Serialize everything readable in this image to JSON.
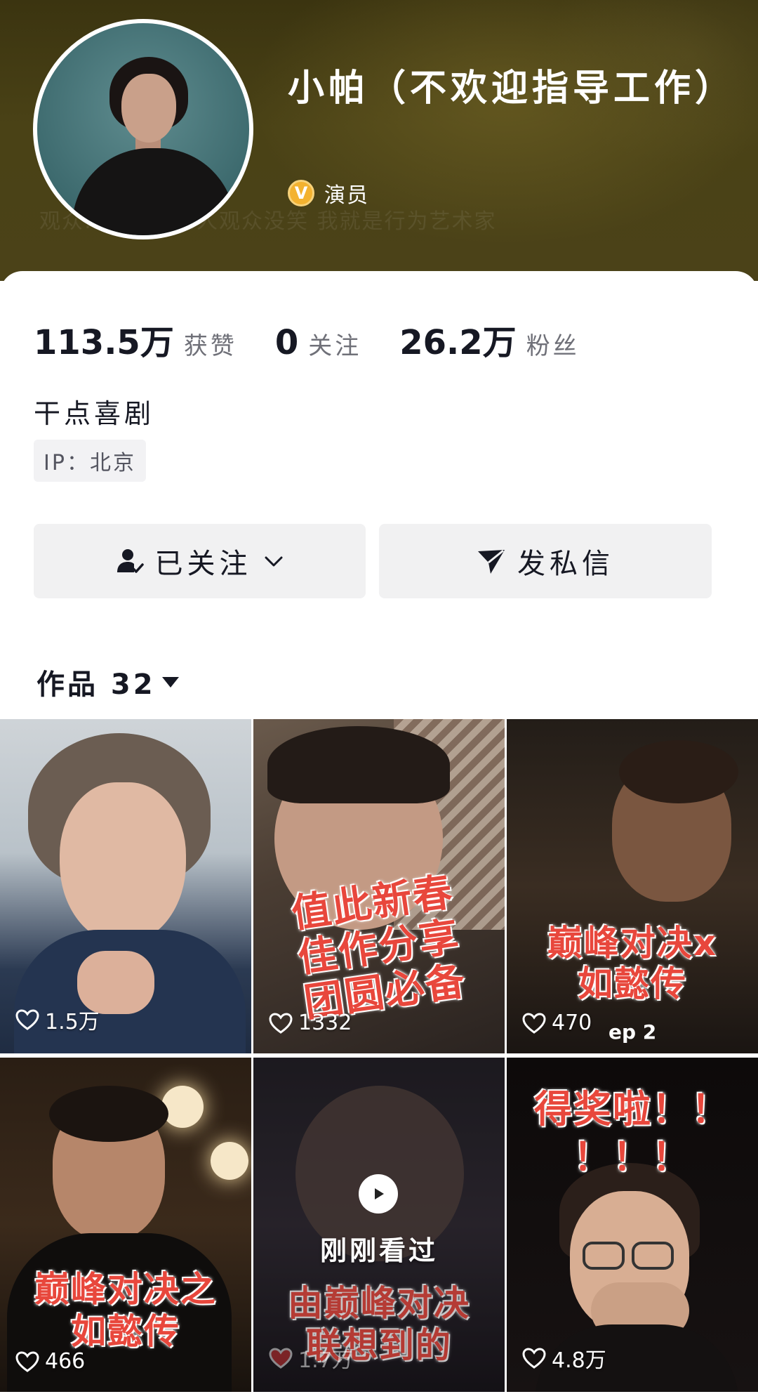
{
  "profile": {
    "name": "小帕（不欢迎指导工作）",
    "badge_letter": "V",
    "role": "演员",
    "header_caption": "观众…是搞笑艺人观众没笑 我就是行为艺术家"
  },
  "stats": [
    {
      "value": "113.5万",
      "label": "获赞"
    },
    {
      "value": "0",
      "label": "关注"
    },
    {
      "value": "26.2万",
      "label": "粉丝"
    }
  ],
  "bio": "干点喜剧",
  "ip_location": "IP：北京",
  "actions": {
    "follow_label": "已关注",
    "message_label": "发私信"
  },
  "works_tab": {
    "label": "作品 32"
  },
  "videos": [
    {
      "likes": "1.5万",
      "overlay": ""
    },
    {
      "likes": "1332",
      "overlay_lines": [
        "值此新春",
        "佳作分享",
        "团圆必备"
      ]
    },
    {
      "likes": "470",
      "overlay_lines": [
        "巅峰对决x",
        "如懿传"
      ],
      "tag": "ep 2"
    },
    {
      "likes": "466",
      "overlay_lines": [
        "巅峰对决之",
        "如懿传"
      ]
    },
    {
      "likes": "1.7万",
      "overlay_lines": [
        "由巅峰对决",
        "联想到的"
      ],
      "watched_label": "刚刚看过"
    },
    {
      "likes": "4.8万",
      "overlay_lines": [
        "得奖啦！！",
        "！！！"
      ]
    }
  ],
  "colors": {
    "header_bg": "#4a4216",
    "badge": "#f3b230",
    "overlay_text": "#e8473c",
    "button_bg": "#f1f1f2"
  }
}
